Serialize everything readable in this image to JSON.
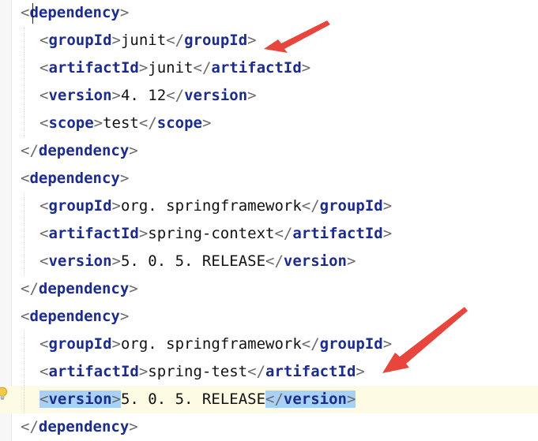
{
  "editor": {
    "lines": [
      {
        "indent": 0,
        "parts": [
          {
            "k": "br",
            "t": "<"
          },
          {
            "k": "tag",
            "t": "dependency"
          },
          {
            "k": "br",
            "t": ">"
          }
        ]
      },
      {
        "indent": 1,
        "parts": [
          {
            "k": "br",
            "t": "<"
          },
          {
            "k": "tag",
            "t": "groupId"
          },
          {
            "k": "br",
            "t": ">"
          },
          {
            "k": "txt",
            "t": "junit"
          },
          {
            "k": "br",
            "t": "</"
          },
          {
            "k": "tag",
            "t": "groupId"
          },
          {
            "k": "br",
            "t": ">"
          }
        ]
      },
      {
        "indent": 1,
        "parts": [
          {
            "k": "br",
            "t": "<"
          },
          {
            "k": "tag",
            "t": "artifactId"
          },
          {
            "k": "br",
            "t": ">"
          },
          {
            "k": "txt",
            "t": "junit"
          },
          {
            "k": "br",
            "t": "</"
          },
          {
            "k": "tag",
            "t": "artifactId"
          },
          {
            "k": "br",
            "t": ">"
          }
        ]
      },
      {
        "indent": 1,
        "parts": [
          {
            "k": "br",
            "t": "<"
          },
          {
            "k": "tag",
            "t": "version"
          },
          {
            "k": "br",
            "t": ">"
          },
          {
            "k": "txt",
            "t": "4. 12"
          },
          {
            "k": "br",
            "t": "</"
          },
          {
            "k": "tag",
            "t": "version"
          },
          {
            "k": "br",
            "t": ">"
          }
        ]
      },
      {
        "indent": 1,
        "parts": [
          {
            "k": "br",
            "t": "<"
          },
          {
            "k": "tag",
            "t": "scope"
          },
          {
            "k": "br",
            "t": ">"
          },
          {
            "k": "txt",
            "t": "test"
          },
          {
            "k": "br",
            "t": "</"
          },
          {
            "k": "tag",
            "t": "scope"
          },
          {
            "k": "br",
            "t": ">"
          }
        ]
      },
      {
        "indent": 0,
        "parts": [
          {
            "k": "br",
            "t": "</"
          },
          {
            "k": "tag",
            "t": "dependency"
          },
          {
            "k": "br",
            "t": ">"
          }
        ]
      },
      {
        "indent": 0,
        "parts": [
          {
            "k": "br",
            "t": "<"
          },
          {
            "k": "tag",
            "t": "dependency"
          },
          {
            "k": "br",
            "t": ">"
          }
        ]
      },
      {
        "indent": 1,
        "parts": [
          {
            "k": "br",
            "t": "<"
          },
          {
            "k": "tag",
            "t": "groupId"
          },
          {
            "k": "br",
            "t": ">"
          },
          {
            "k": "txt",
            "t": "org. springframework"
          },
          {
            "k": "br",
            "t": "</"
          },
          {
            "k": "tag",
            "t": "groupId"
          },
          {
            "k": "br",
            "t": ">"
          }
        ]
      },
      {
        "indent": 1,
        "parts": [
          {
            "k": "br",
            "t": "<"
          },
          {
            "k": "tag",
            "t": "artifactId"
          },
          {
            "k": "br",
            "t": ">"
          },
          {
            "k": "txt",
            "t": "spring-context"
          },
          {
            "k": "br",
            "t": "</"
          },
          {
            "k": "tag",
            "t": "artifactId"
          },
          {
            "k": "br",
            "t": ">"
          }
        ]
      },
      {
        "indent": 1,
        "parts": [
          {
            "k": "br",
            "t": "<"
          },
          {
            "k": "tag",
            "t": "version"
          },
          {
            "k": "br",
            "t": ">"
          },
          {
            "k": "txt",
            "t": "5. 0. 5. RELEASE"
          },
          {
            "k": "br",
            "t": "</"
          },
          {
            "k": "tag",
            "t": "version"
          },
          {
            "k": "br",
            "t": ">"
          }
        ]
      },
      {
        "indent": 0,
        "parts": [
          {
            "k": "br",
            "t": "</"
          },
          {
            "k": "tag",
            "t": "dependency"
          },
          {
            "k": "br",
            "t": ">"
          }
        ]
      },
      {
        "indent": 0,
        "parts": [
          {
            "k": "br",
            "t": "<"
          },
          {
            "k": "tag",
            "t": "dependency"
          },
          {
            "k": "br",
            "t": ">"
          }
        ]
      },
      {
        "indent": 1,
        "parts": [
          {
            "k": "br",
            "t": "<"
          },
          {
            "k": "tag",
            "t": "groupId"
          },
          {
            "k": "br",
            "t": ">"
          },
          {
            "k": "txt",
            "t": "org. springframework"
          },
          {
            "k": "br",
            "t": "</"
          },
          {
            "k": "tag",
            "t": "groupId"
          },
          {
            "k": "br",
            "t": ">"
          }
        ]
      },
      {
        "indent": 1,
        "parts": [
          {
            "k": "br",
            "t": "<"
          },
          {
            "k": "tag",
            "t": "artifactId"
          },
          {
            "k": "br",
            "t": ">"
          },
          {
            "k": "txt",
            "t": "spring-test"
          },
          {
            "k": "br",
            "t": "</"
          },
          {
            "k": "tag",
            "t": "artifactId"
          },
          {
            "k": "br",
            "t": ">"
          }
        ]
      },
      {
        "indent": 1,
        "current": true,
        "parts": [
          {
            "k": "br",
            "t": "<",
            "hl": true
          },
          {
            "k": "tag",
            "t": "version",
            "hl": true
          },
          {
            "k": "br",
            "t": ">",
            "hl": true
          },
          {
            "k": "txt",
            "t": "5. 0. 5. RELEASE"
          },
          {
            "k": "br",
            "t": "</",
            "hl": true
          },
          {
            "k": "tag",
            "t": "version",
            "hl": true
          },
          {
            "k": "br",
            "t": ">",
            "hl": true
          }
        ]
      },
      {
        "indent": 0,
        "parts": [
          {
            "k": "br",
            "t": "</"
          },
          {
            "k": "tag",
            "t": "dependency"
          },
          {
            "k": "br",
            "t": ">"
          }
        ]
      }
    ]
  },
  "gutter": {
    "bulb_icon": "lightbulb-icon"
  },
  "annotations": [
    {
      "icon": "red-arrow-icon",
      "target": "junit groupId",
      "color": "#e8453c"
    },
    {
      "icon": "red-arrow-icon",
      "target": "spring-test artifactId",
      "color": "#e8453c"
    }
  ],
  "colors": {
    "tag": "#1c2c8c",
    "bracket": "#6b6b6b",
    "text": "#111111",
    "match_highlight": "#a9d1f5",
    "current_line": "#fdfbe4"
  }
}
